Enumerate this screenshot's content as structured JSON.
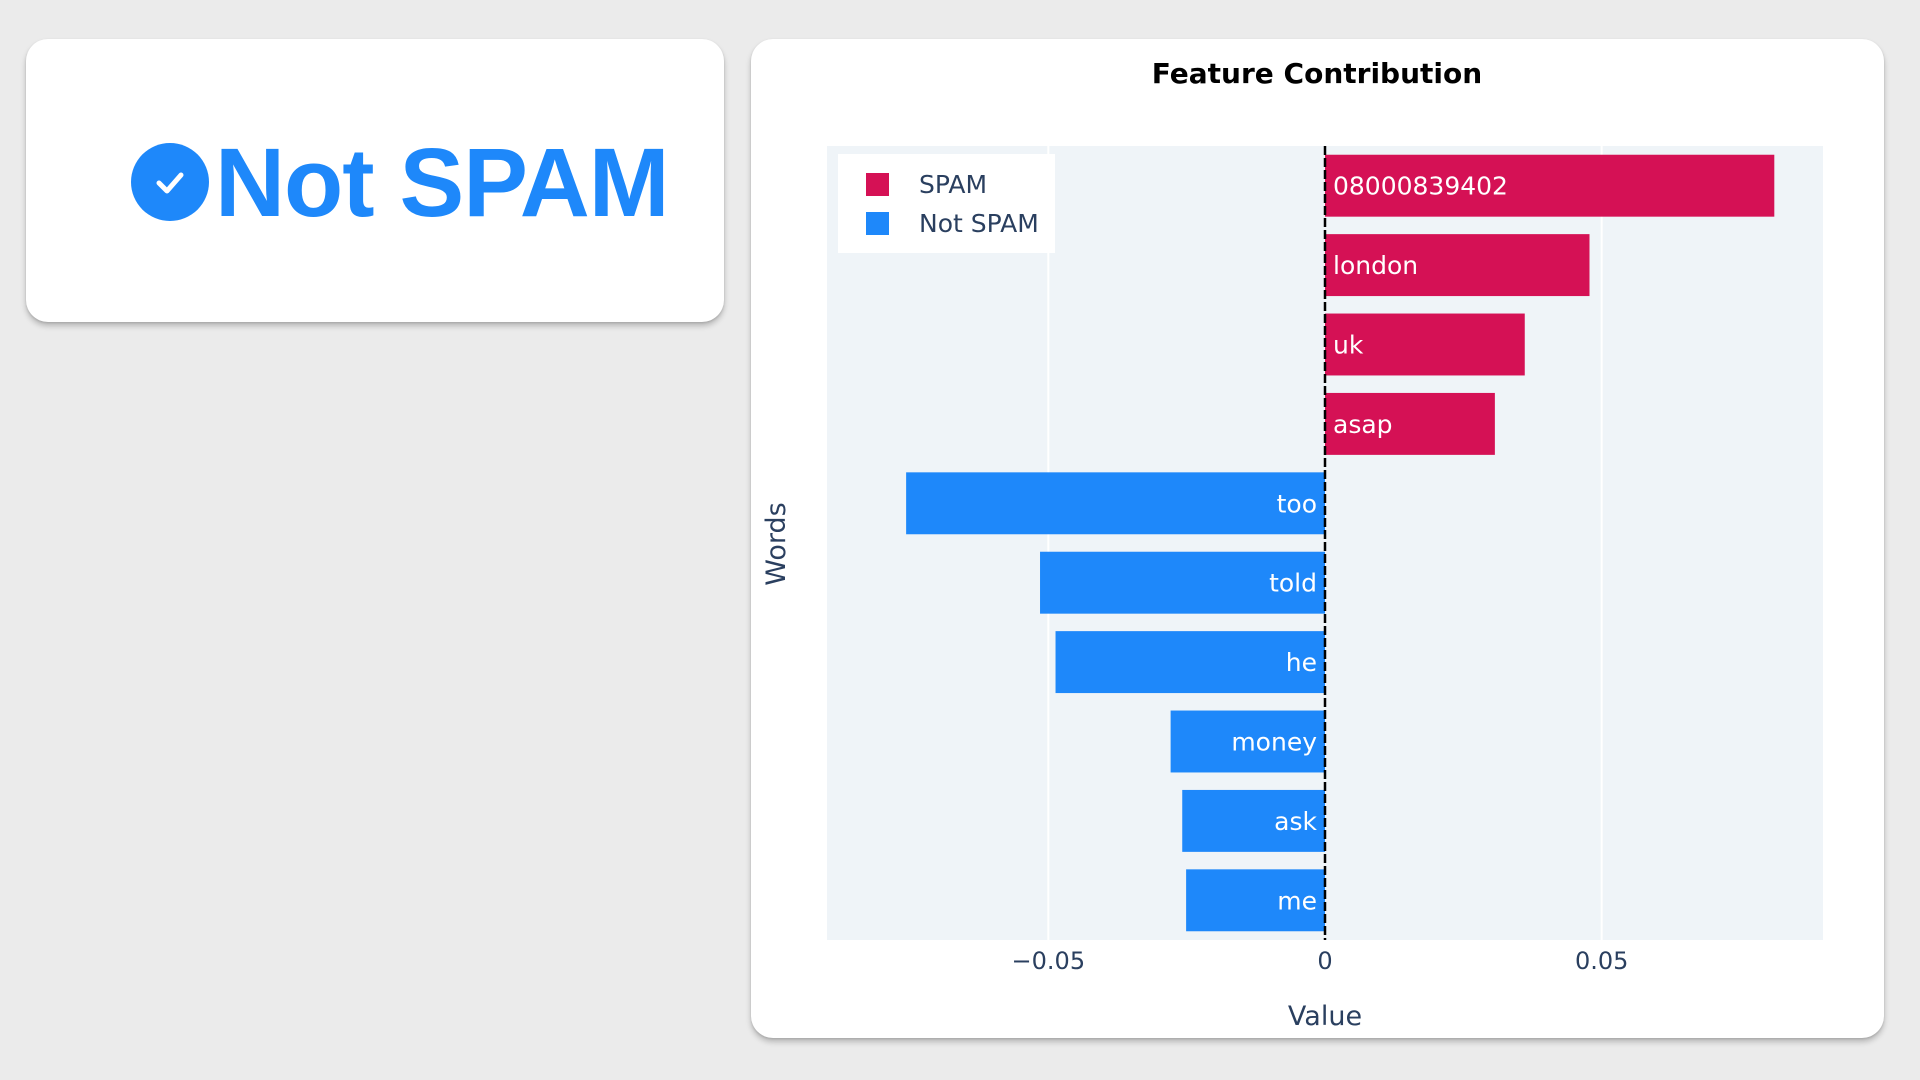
{
  "prediction": {
    "label": "Not SPAM",
    "icon": "check-circle-icon",
    "color": "#1e88fa"
  },
  "chart_data": {
    "type": "bar",
    "orientation": "horizontal",
    "title": "Feature Contribution",
    "xlabel": "Value",
    "ylabel": "Words",
    "xlim": [
      -0.09,
      0.09
    ],
    "xticks": [
      -0.05,
      0,
      0.05
    ],
    "xtick_labels": [
      "−0.05",
      "0",
      "0.05"
    ],
    "grid": true,
    "legend_position": "top-left",
    "series": [
      {
        "name": "SPAM",
        "color": "#d51155",
        "categories": [
          "08000839402",
          "london",
          "uk",
          "asap"
        ],
        "values": [
          0.0812,
          0.0478,
          0.0361,
          0.0307
        ]
      },
      {
        "name": "Not SPAM",
        "color": "#1e88fa",
        "categories": [
          "too",
          "told",
          "he",
          "money",
          "ask",
          "me"
        ],
        "values": [
          -0.0757,
          -0.0515,
          -0.0487,
          -0.0279,
          -0.0258,
          -0.0251
        ]
      }
    ]
  }
}
